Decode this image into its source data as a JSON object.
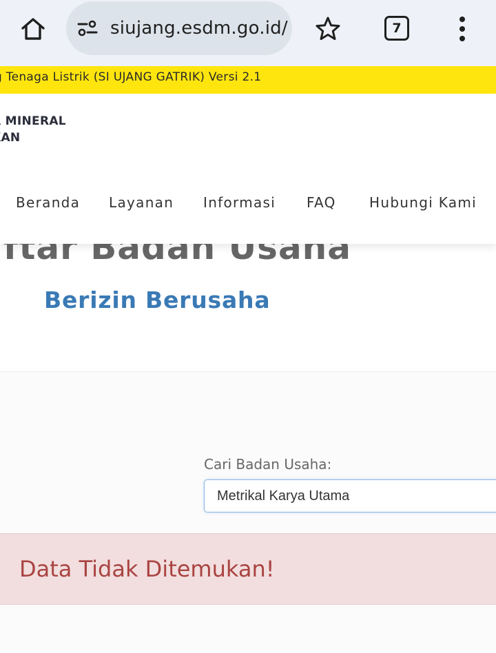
{
  "browser": {
    "url": "siujang.esdm.go.id/",
    "tab_count": "7",
    "icons": [
      "home-icon",
      "site-settings-icon",
      "star-icon",
      "tabs-icon",
      "more-vert-icon"
    ]
  },
  "announcement": "g Tenaga Listrik (SI UJANG GATRIK) Versi 2.1",
  "brand": {
    "line1": "A MINERAL",
    "line2": "KAN"
  },
  "nav": {
    "items": [
      {
        "label": "Beranda"
      },
      {
        "label": "Layanan"
      },
      {
        "label": "Informasi"
      },
      {
        "label": "FAQ"
      },
      {
        "label": "Hubungi Kami"
      }
    ]
  },
  "hero": {
    "title": "aftar Badan Usaha",
    "subtitle": "Berizin Berusaha"
  },
  "search": {
    "label": "Cari Badan Usaha:",
    "value": "Metrikal Karya Utama"
  },
  "alert": {
    "message": "Data Tidak Ditemukan!"
  },
  "colors": {
    "announcement_bg": "#ffe50e",
    "accent": "#3a7ab5",
    "alert_bg": "#f2dede",
    "alert_text": "#a94442"
  }
}
